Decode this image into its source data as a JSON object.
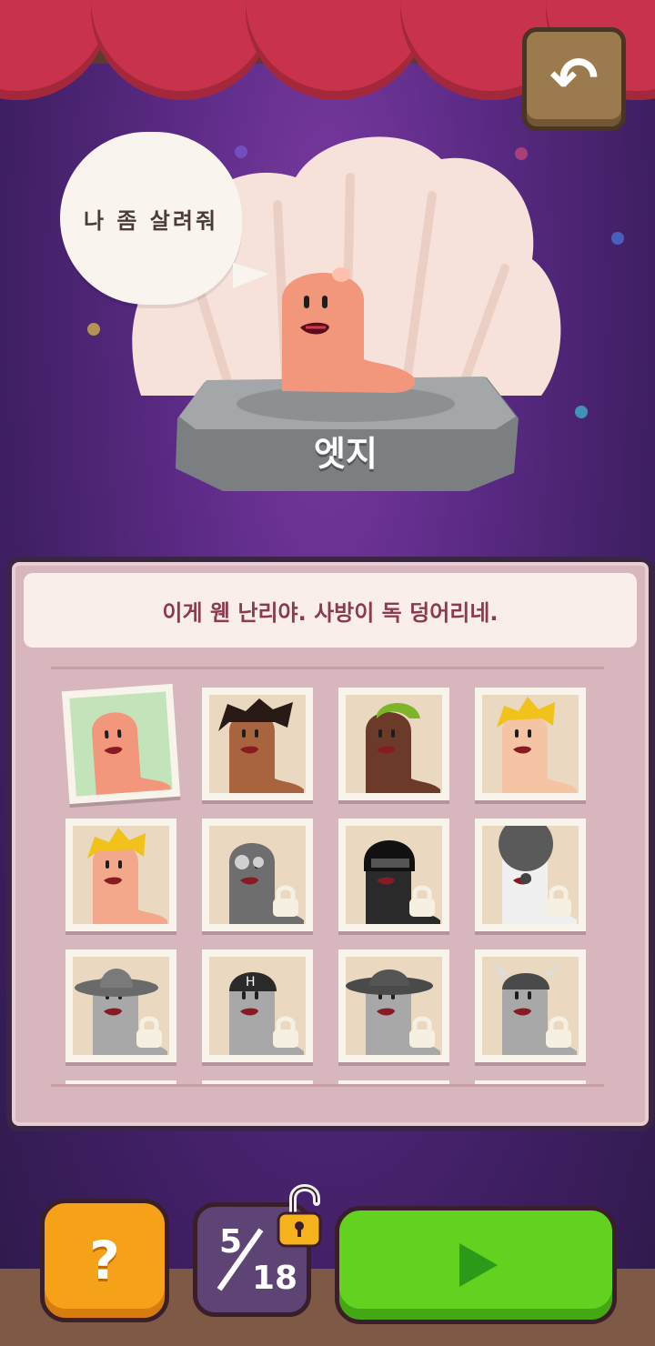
{
  "header": {
    "back_icon": "back-arrow-icon"
  },
  "showcase": {
    "speech_bubble": "나 좀 살려줘",
    "character_name": "엣지"
  },
  "panel": {
    "dialogue": "이게 웬 난리야. 사방이 독 덩어리네."
  },
  "characters": [
    {
      "locked": false,
      "selected": true,
      "skin": "#f2967c",
      "hat": "none"
    },
    {
      "locked": false,
      "selected": false,
      "skin": "#a8643e",
      "hat": "wild-hair"
    },
    {
      "locked": false,
      "selected": false,
      "skin": "#6b3a28",
      "hat": "green-beanie"
    },
    {
      "locked": false,
      "selected": false,
      "skin": "#f5c4a4",
      "hat": "blonde-curl"
    },
    {
      "locked": false,
      "selected": false,
      "skin": "#f3a88c",
      "hat": "blonde-spiky"
    },
    {
      "locked": true,
      "selected": false,
      "skin": "#6e6e6e",
      "hat": "zombie"
    },
    {
      "locked": true,
      "selected": false,
      "skin": "#2a2a2a",
      "hat": "ninja"
    },
    {
      "locked": true,
      "selected": false,
      "skin": "#f0f0f0",
      "hat": "clown-afro"
    },
    {
      "locked": true,
      "selected": false,
      "skin": "#a8a8a8",
      "hat": "sombrero"
    },
    {
      "locked": true,
      "selected": false,
      "skin": "#a8a8a8",
      "hat": "h-helmet"
    },
    {
      "locked": true,
      "selected": false,
      "skin": "#a8a8a8",
      "hat": "cowboy"
    },
    {
      "locked": true,
      "selected": false,
      "skin": "#a8a8a8",
      "hat": "viking"
    },
    {
      "locked": true,
      "selected": false,
      "skin": "#a8a8a8",
      "hat": "partial"
    },
    {
      "locked": true,
      "selected": false,
      "skin": "#a8a8a8",
      "hat": "partial"
    },
    {
      "locked": true,
      "selected": false,
      "skin": "#a8a8a8",
      "hat": "partial"
    },
    {
      "locked": true,
      "selected": false,
      "skin": "#a8a8a8",
      "hat": "partial"
    }
  ],
  "footer": {
    "help_label": "?",
    "unlocked_count": "5",
    "total_count": "18",
    "help_icon": "question-icon",
    "unlock_icon": "open-padlock-icon",
    "play_icon": "play-icon"
  },
  "colors": {
    "curtain": "#c8324a",
    "panel": "#d8b6bd",
    "play_button": "#62d11f",
    "help_button": "#f5a219",
    "counter_bg": "#5e4474"
  }
}
